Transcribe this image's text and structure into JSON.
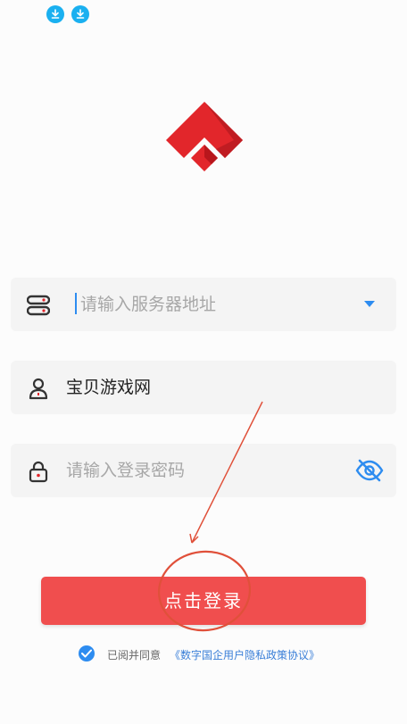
{
  "status_bar": {
    "icons": [
      "download-icon",
      "download-icon"
    ],
    "icon_color": "#1ab0f0"
  },
  "brand": {
    "logo_icon": "red-diamond-logo",
    "logo_color": "#e2262b"
  },
  "form": {
    "server_field": {
      "icon": "server-icon",
      "placeholder": "请输入服务器地址",
      "dropdown_icon": "caret-down-icon"
    },
    "username_field": {
      "icon": "user-icon",
      "value": "宝贝游戏网"
    },
    "password_field": {
      "icon": "lock-icon",
      "placeholder": "请输入登录密码",
      "visibility_icon": "eye-off-icon"
    }
  },
  "login_button": {
    "label": "点击登录",
    "color": "#f04e4e"
  },
  "agreement": {
    "checked": true,
    "prefix": "已阅并同意",
    "link": "《数字国企用户隐私政策协议》",
    "link_color": "#3a7fd8"
  },
  "annotation": {
    "color": "#e0503a"
  }
}
